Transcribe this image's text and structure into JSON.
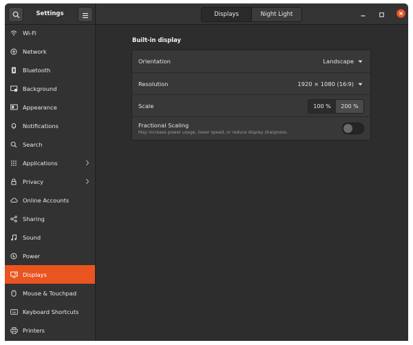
{
  "app": {
    "title": "Settings"
  },
  "header": {
    "tabs": [
      {
        "label": "Displays",
        "active": true
      },
      {
        "label": "Night Light",
        "active": false
      }
    ]
  },
  "sidebar": {
    "items": [
      {
        "label": "Wi-Fi",
        "icon": "wifi-icon"
      },
      {
        "label": "Network",
        "icon": "network-icon"
      },
      {
        "label": "Bluetooth",
        "icon": "bluetooth-icon"
      },
      {
        "label": "Background",
        "icon": "background-icon"
      },
      {
        "label": "Appearance",
        "icon": "appearance-icon"
      },
      {
        "label": "Notifications",
        "icon": "bell-icon"
      },
      {
        "label": "Search",
        "icon": "search-icon"
      },
      {
        "label": "Applications",
        "icon": "apps-grid-icon",
        "chevron": true
      },
      {
        "label": "Privacy",
        "icon": "lock-icon",
        "chevron": true
      },
      {
        "label": "Online Accounts",
        "icon": "cloud-icon"
      },
      {
        "label": "Sharing",
        "icon": "share-icon"
      },
      {
        "label": "Sound",
        "icon": "music-note-icon"
      },
      {
        "label": "Power",
        "icon": "power-icon"
      },
      {
        "label": "Displays",
        "icon": "display-icon",
        "active": true
      },
      {
        "label": "Mouse & Touchpad",
        "icon": "mouse-icon"
      },
      {
        "label": "Keyboard Shortcuts",
        "icon": "keyboard-icon"
      },
      {
        "label": "Printers",
        "icon": "printer-icon"
      }
    ]
  },
  "display": {
    "section_title": "Built-in display",
    "orientation": {
      "label": "Orientation",
      "value": "Landscape"
    },
    "resolution": {
      "label": "Resolution",
      "value": "1920 × 1080 (16∶9)"
    },
    "scale": {
      "label": "Scale",
      "options": [
        "100 %",
        "200 %"
      ],
      "selected": "200 %"
    },
    "fractional": {
      "label": "Fractional Scaling",
      "description": "May increase power usage, lower speed, or reduce display sharpness.",
      "enabled": false
    }
  },
  "colors": {
    "accent": "#e95420",
    "window_bg": "#2d2d2d",
    "card_bg": "#383838"
  }
}
